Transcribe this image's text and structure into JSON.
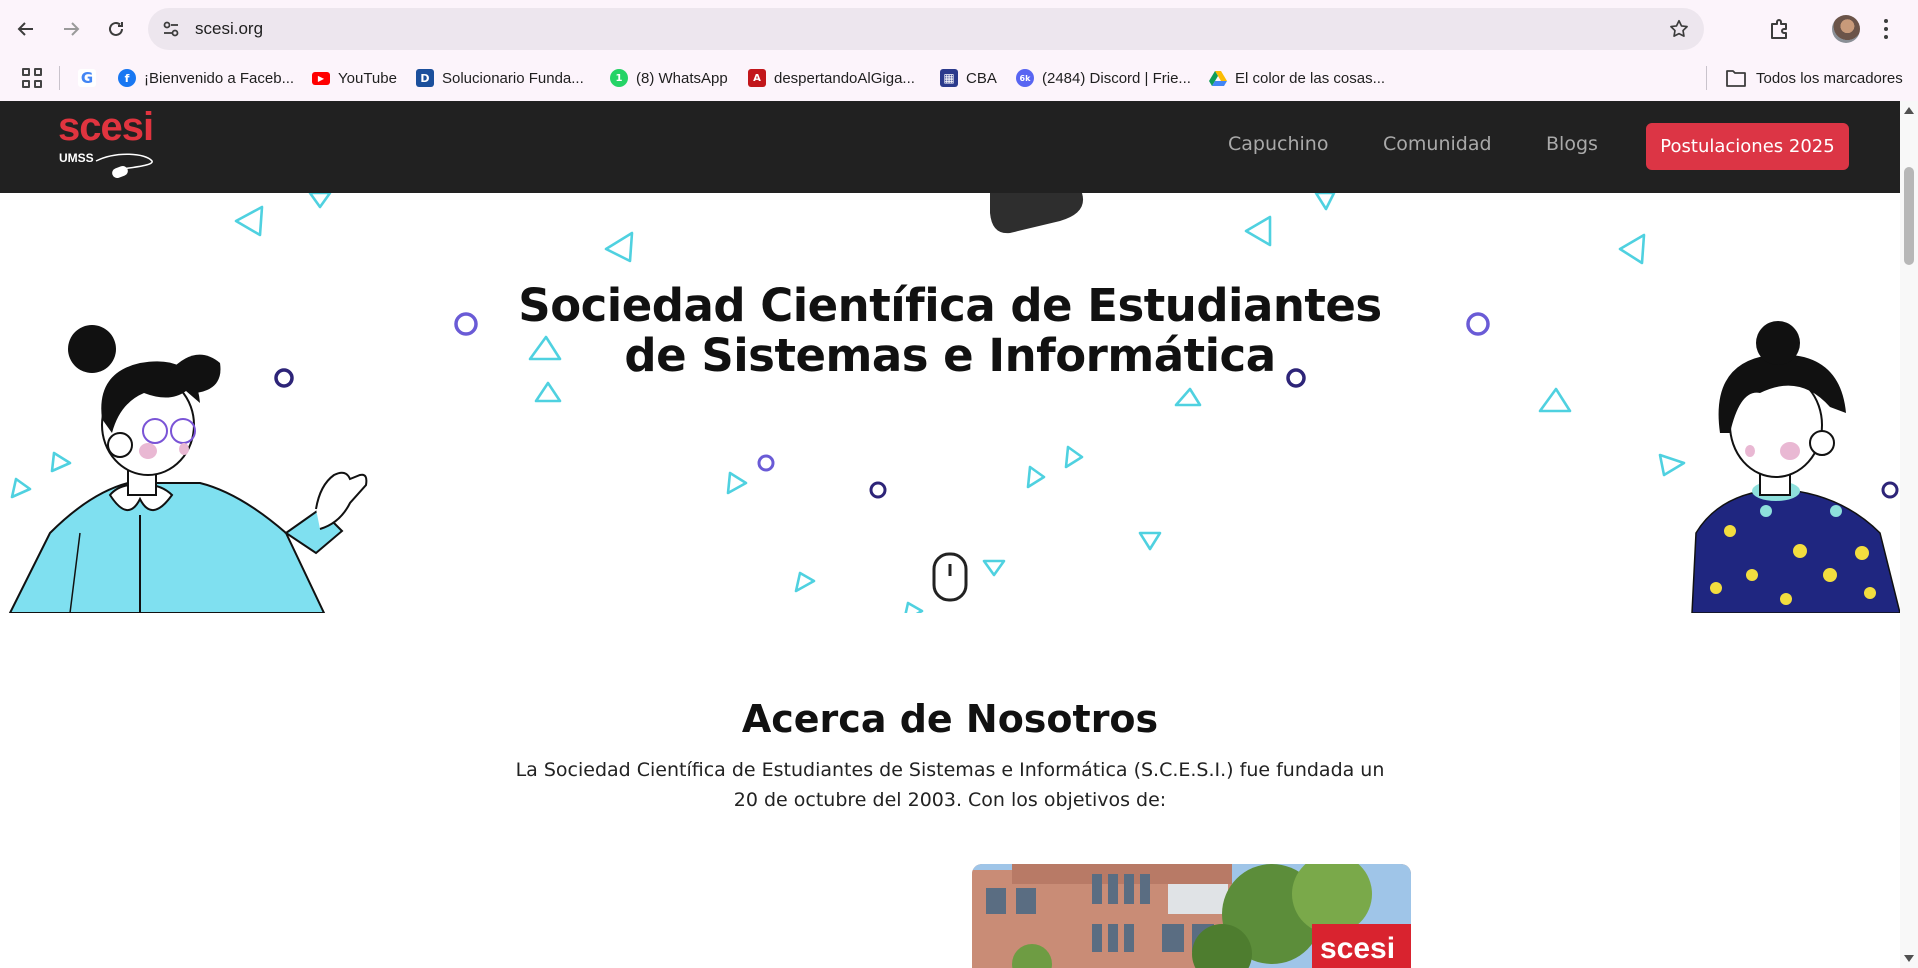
{
  "browser": {
    "url": "scesi.org",
    "bookmarks": [
      {
        "label": "¡Bienvenido a Faceb...",
        "icon": "facebook-icon",
        "color": "#1877f2"
      },
      {
        "label": "YouTube",
        "icon": "youtube-icon",
        "color": "#ff0000"
      },
      {
        "label": "Solucionario Funda...",
        "icon": "document-icon",
        "color": "#1b4f9c"
      },
      {
        "label": "(8) WhatsApp",
        "icon": "whatsapp-icon",
        "color": "#25d366"
      },
      {
        "label": "despertandoAlGiga...",
        "icon": "pdf-icon",
        "color": "#c2161b"
      },
      {
        "label": "CBA",
        "icon": "grid-icon",
        "color": "#2b3a8c"
      },
      {
        "label": "(2484) Discord | Frie...",
        "icon": "discord-icon",
        "color": "#5865f2"
      },
      {
        "label": "El color de las cosas...",
        "icon": "google-drive-icon",
        "color": "#0f9d58"
      }
    ],
    "all_bookmarks": "Todos los marcadores"
  },
  "site": {
    "logo_text": "scesi",
    "logo_sub": "UMSS",
    "nav": {
      "links": [
        "Capuchino",
        "Comunidad",
        "Blogs"
      ],
      "cta": "Postulaciones 2025"
    },
    "hero": {
      "title_line1": "Sociedad Científica de Estudiantes",
      "title_line2": "de Sistemas e Informática"
    },
    "about": {
      "title": "Acerca de Nosotros",
      "text_line1": "La Sociedad Científica de Estudiantes de Sistemas e Informática (S.C.E.S.I.) fue fundada un",
      "text_line2": "20 de octubre del 2003. Con los objetivos de:"
    },
    "photo_sign": "scesi"
  },
  "colors": {
    "nav_bg": "#212121",
    "brand_red": "#dc3545",
    "triangle": "#4fd1e0",
    "circle_purple": "#6a5bd6",
    "circle_dark": "#2d2478"
  }
}
